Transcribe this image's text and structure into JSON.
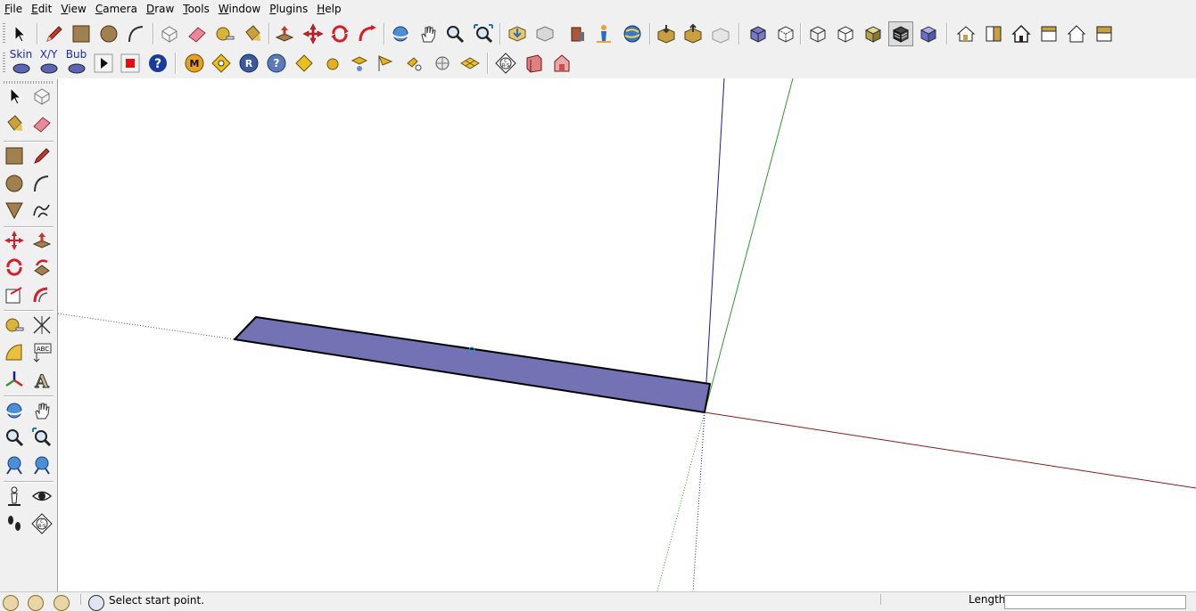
{
  "menu": [
    {
      "accel": "F",
      "rest": "ile"
    },
    {
      "accel": "E",
      "rest": "dit"
    },
    {
      "accel": "V",
      "rest": "iew"
    },
    {
      "accel": "C",
      "rest": "amera"
    },
    {
      "accel": "D",
      "rest": "raw"
    },
    {
      "accel": "T",
      "rest": "ools"
    },
    {
      "accel": "W",
      "rest": "indow"
    },
    {
      "accel": "P",
      "rest": "lugins"
    },
    {
      "accel": "H",
      "rest": "elp"
    }
  ],
  "plugin_buttons": {
    "skin": "Skin",
    "xy": "X/Y",
    "bub": "Bub"
  },
  "left_toolbar": {
    "text_tool_label": "ABC"
  },
  "status": {
    "text": "Select start point.",
    "measurements_label": "Length"
  },
  "colors": {
    "face_fill": "#7272b4",
    "red_axis": "#8b1a1a",
    "green_axis": "#2e9a2e",
    "blue_axis": "#1a1aa0"
  }
}
